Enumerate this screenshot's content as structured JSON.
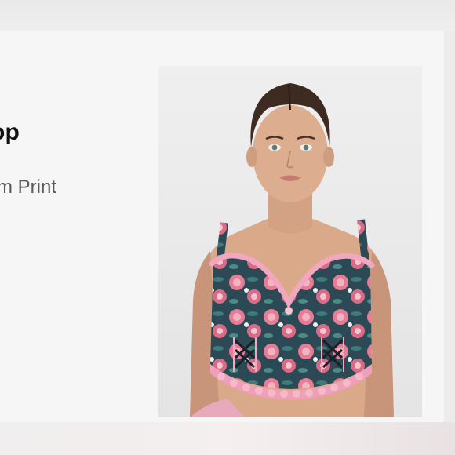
{
  "product": {
    "title": "op",
    "subtitle": "m Print"
  },
  "image": {
    "alt_icon": "product-photo",
    "skin": "#dcae8f",
    "hair": "#3d2a20",
    "print_base": "#2b4a55",
    "print_rose": "#e77d95",
    "lace_pink": "#f2a7bf",
    "lace_trim": "#ef9fb7",
    "ribbon": "#1e1e28"
  }
}
